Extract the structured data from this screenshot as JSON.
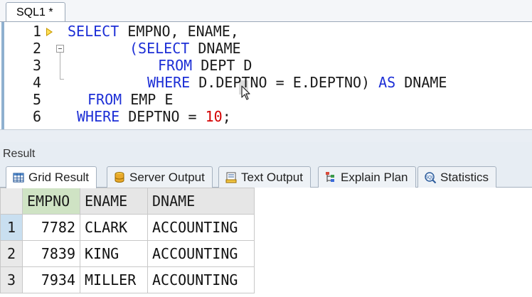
{
  "editor_tab": {
    "label": "SQL1 *"
  },
  "editor": {
    "line_numbers": [
      "1",
      "2",
      "3",
      "4",
      "5",
      "6"
    ],
    "lines": [
      [
        "SELECT",
        " EMPNO, ENAME,"
      ],
      [
        "(SELECT",
        " DNAME"
      ],
      [
        "FROM",
        " DEPT D"
      ],
      [
        "WHERE",
        " D.DEPTNO = E.DEPTNO) ",
        "AS",
        " DNAME"
      ],
      [
        "FROM",
        " EMP E"
      ],
      [
        "WHERE",
        " DEPTNO = ",
        "10",
        ";"
      ]
    ]
  },
  "result": {
    "title": "Result",
    "tabs": [
      {
        "label": "Grid Result",
        "icon": "grid-icon"
      },
      {
        "label": "Server Output",
        "icon": "database-icon"
      },
      {
        "label": "Text Output",
        "icon": "text-output-icon"
      },
      {
        "label": "Explain Plan",
        "icon": "explain-plan-icon"
      },
      {
        "label": "Statistics",
        "icon": "sql-statistics-icon"
      }
    ],
    "grid": {
      "columns": [
        "EMPNO",
        "ENAME",
        "DNAME"
      ],
      "rows": [
        {
          "num": "1",
          "empno": "7782",
          "ename": "CLARK",
          "dname": "ACCOUNTING"
        },
        {
          "num": "2",
          "empno": "7839",
          "ename": "KING",
          "dname": "ACCOUNTING"
        },
        {
          "num": "3",
          "empno": "7934",
          "ename": "MILLER",
          "dname": "ACCOUNTING"
        }
      ]
    }
  },
  "colors": {
    "keyword": "#1d2fd6",
    "number_literal": "#d40000",
    "selected_header": "#cfe3c4"
  }
}
